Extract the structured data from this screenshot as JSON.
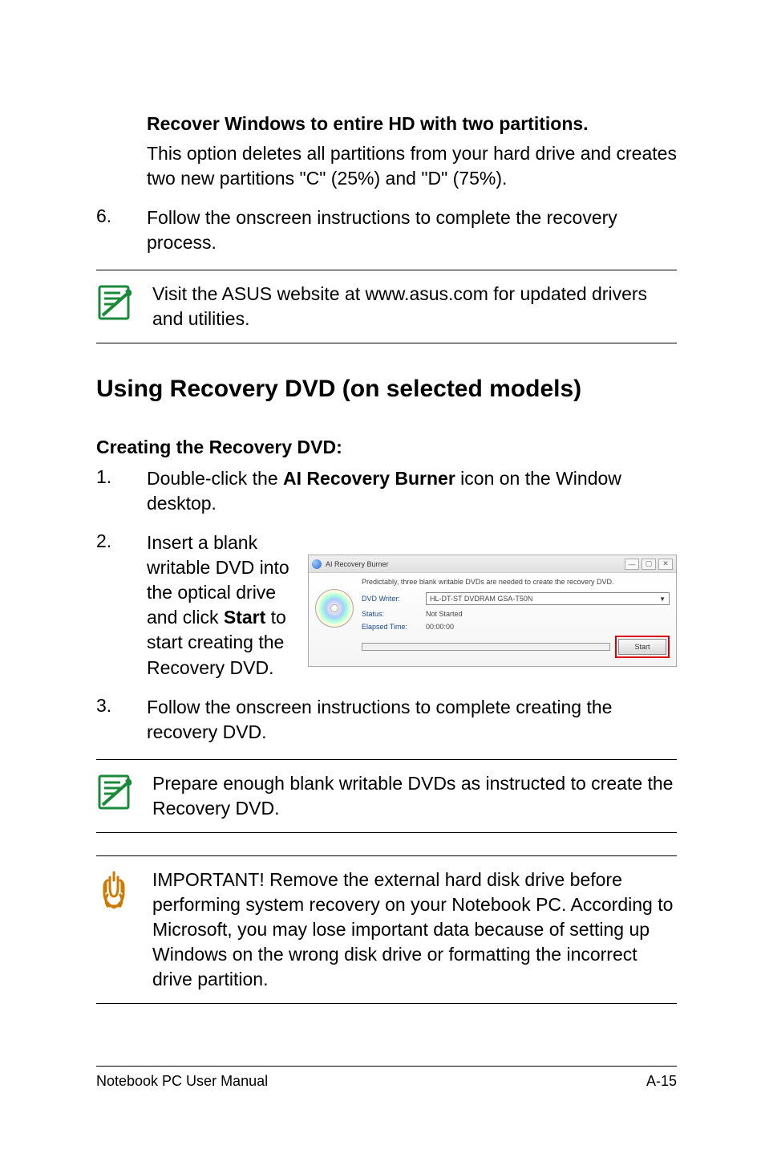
{
  "top": {
    "opt_heading": "Recover Windows to entire HD with two partitions.",
    "opt_body": "This option deletes all partitions from your hard drive and creates two new partitions \"C\" (25%) and \"D\" (75%)."
  },
  "step6": {
    "num": "6.",
    "text": "Follow the onscreen instructions to complete the recovery process."
  },
  "note1": "Visit the ASUS website at www.asus.com for updated drivers and utilities.",
  "section_title": "Using Recovery DVD (on selected models)",
  "create_heading": "Creating the Recovery DVD:",
  "step1": {
    "num": "1.",
    "pre": "Double-click the ",
    "bold": "AI Recovery Burner",
    "post": " icon on the Window desktop."
  },
  "step2": {
    "num": "2.",
    "pre1": "Insert a blank writable DVD into the optical drive and click ",
    "bold": "Start",
    "post": " to start creating the Recovery DVD."
  },
  "arb": {
    "title": "AI Recovery Burner",
    "min": "—",
    "max": "▢",
    "close": "✕",
    "predict": "Predictably, three blank writable DVDs are needed to create the recovery DVD.",
    "writer_label": "DVD Writer:",
    "writer_value": "HL-DT-ST DVDRAM GSA-T50N",
    "status_label": "Status:",
    "status_value": "Not Started",
    "elapsed_label": "Elapsed Time:",
    "elapsed_value": "00:00:00",
    "start": "Start"
  },
  "step3": {
    "num": "3.",
    "text": "Follow the onscreen instructions to complete creating the recovery DVD."
  },
  "note2": "Prepare enough blank writable DVDs as instructed to create the Recovery DVD.",
  "important": "IMPORTANT! Remove the external hard disk drive before performing system recovery on your Notebook PC. According to Microsoft, you may lose important data because of setting up Windows on the wrong disk drive or formatting the incorrect drive partition.",
  "footer": {
    "left": "Notebook PC User Manual",
    "right": "A-15"
  }
}
